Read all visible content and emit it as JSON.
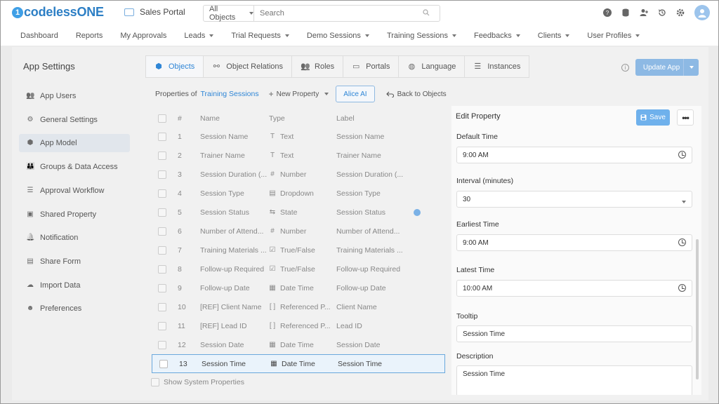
{
  "app": {
    "logo_mark": "1",
    "logo_text": "codelessONE",
    "portal_name": "Sales Portal"
  },
  "search": {
    "scope": "All Objects",
    "placeholder": "Search"
  },
  "nav": [
    "Dashboard",
    "Reports",
    "My Approvals",
    "Leads",
    "Trial Requests",
    "Demo Sessions",
    "Training Sessions",
    "Feedbacks",
    "Clients",
    "User Profiles"
  ],
  "nav_has_caret": [
    false,
    false,
    false,
    true,
    true,
    true,
    true,
    true,
    true,
    true
  ],
  "sidebar": {
    "title": "App Settings",
    "items": [
      {
        "label": "App Users",
        "icon": "users-icon"
      },
      {
        "label": "General Settings",
        "icon": "gear-icon"
      },
      {
        "label": "App Model",
        "icon": "cube-icon"
      },
      {
        "label": "Groups & Data Access",
        "icon": "group-icon"
      },
      {
        "label": "Approval Workflow",
        "icon": "checklist-icon"
      },
      {
        "label": "Shared Property",
        "icon": "shared-icon"
      },
      {
        "label": "Notification",
        "icon": "bell-icon"
      },
      {
        "label": "Share Form",
        "icon": "form-icon"
      },
      {
        "label": "Import Data",
        "icon": "cloud-upload-icon"
      },
      {
        "label": "Preferences",
        "icon": "user-cog-icon"
      }
    ],
    "active_index": 2
  },
  "tabs": [
    "Objects",
    "Object Relations",
    "Roles",
    "Portals",
    "Language",
    "Instances"
  ],
  "toolbar": {
    "update_label": "Update App",
    "properties_of": "Properties of",
    "object_name": "Training Sessions",
    "new_property": "New Property",
    "alice": "Alice AI",
    "back": "Back to Objects"
  },
  "table": {
    "headers": [
      "#",
      "Name",
      "Type",
      "Label"
    ],
    "rows": [
      {
        "num": "1",
        "name": "Session Name",
        "type": "Text",
        "type_icon": "T",
        "label": "Session Name"
      },
      {
        "num": "2",
        "name": "Trainer Name",
        "type": "Text",
        "type_icon": "T",
        "label": "Trainer Name"
      },
      {
        "num": "3",
        "name": "Session Duration (...",
        "type": "Number",
        "type_icon": "#",
        "label": "Session Duration (..."
      },
      {
        "num": "4",
        "name": "Session Type",
        "type": "Dropdown",
        "type_icon": "▤",
        "label": "Session Type"
      },
      {
        "num": "5",
        "name": "Session Status",
        "type": "State",
        "type_icon": "⇆",
        "label": "Session Status"
      },
      {
        "num": "6",
        "name": "Number of Attend...",
        "type": "Number",
        "type_icon": "#",
        "label": "Number of Attend..."
      },
      {
        "num": "7",
        "name": "Training Materials ...",
        "type": "True/False",
        "type_icon": "☑",
        "label": "Training Materials ..."
      },
      {
        "num": "8",
        "name": "Follow-up Required",
        "type": "True/False",
        "type_icon": "☑",
        "label": "Follow-up Required"
      },
      {
        "num": "9",
        "name": "Follow-up Date",
        "type": "Date Time",
        "type_icon": "▦",
        "label": "Follow-up Date"
      },
      {
        "num": "10",
        "name": "[REF] Client Name",
        "type": "Referenced P...",
        "type_icon": "[ ]",
        "label": "Client Name"
      },
      {
        "num": "11",
        "name": "[REF] Lead ID",
        "type": "Referenced P...",
        "type_icon": "[ ]",
        "label": "Lead ID"
      },
      {
        "num": "12",
        "name": "Session Date",
        "type": "Date Time",
        "type_icon": "▦",
        "label": "Session Date"
      },
      {
        "num": "13",
        "name": "Session Time",
        "type": "Date Time",
        "type_icon": "▦",
        "label": "Session Time"
      }
    ],
    "selected_index": 12,
    "show_system": "Show System Properties"
  },
  "edit": {
    "title": "Edit Property",
    "save": "Save",
    "default_time_label": "Default Time",
    "default_time": "9:00 AM",
    "interval_label": "Interval (minutes)",
    "interval": "30",
    "earliest_label": "Earliest Time",
    "earliest": "9:00 AM",
    "latest_label": "Latest Time",
    "latest": "10:00 AM",
    "tooltip_label": "Tooltip",
    "tooltip": "Session Time",
    "description_label": "Description",
    "description": "Session Time"
  }
}
